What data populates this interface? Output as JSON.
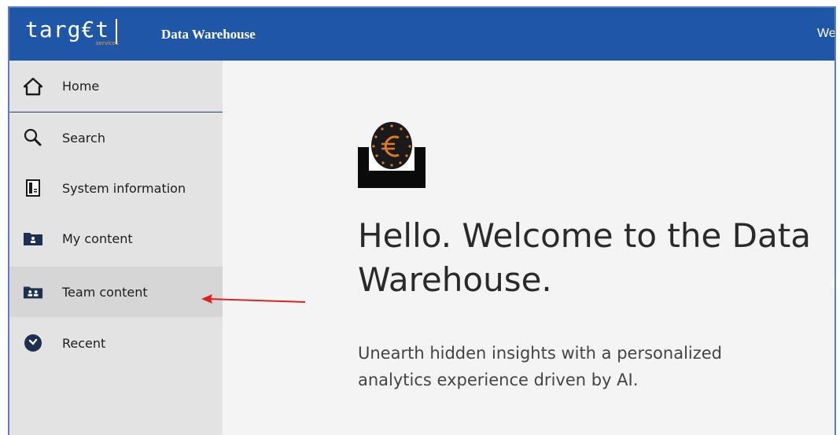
{
  "header": {
    "logo_text": "targ€t",
    "logo_sub": "services",
    "app_title": "Data Warehouse",
    "welcome_text": "Wel"
  },
  "sidebar": {
    "items": [
      {
        "label": "Home",
        "icon": "home-icon"
      },
      {
        "label": "Search",
        "icon": "search-icon"
      },
      {
        "label": "System information",
        "icon": "system-info-icon"
      },
      {
        "label": "My content",
        "icon": "my-content-folder-icon"
      },
      {
        "label": "Team content",
        "icon": "team-content-folder-icon",
        "selected": true
      },
      {
        "label": "Recent",
        "icon": "recent-clock-icon"
      }
    ]
  },
  "main": {
    "headline": "Hello. Welcome to the Data Warehouse.",
    "tagline": "Unearth hidden insights with a personalized analytics experience driven by AI."
  },
  "colors": {
    "header_bg": "#1f57a6",
    "sidebar_bg": "#e3e3e3",
    "content_bg": "#f4f4f4",
    "arrow": "#e02020",
    "euro_accent": "#e07a1f"
  }
}
